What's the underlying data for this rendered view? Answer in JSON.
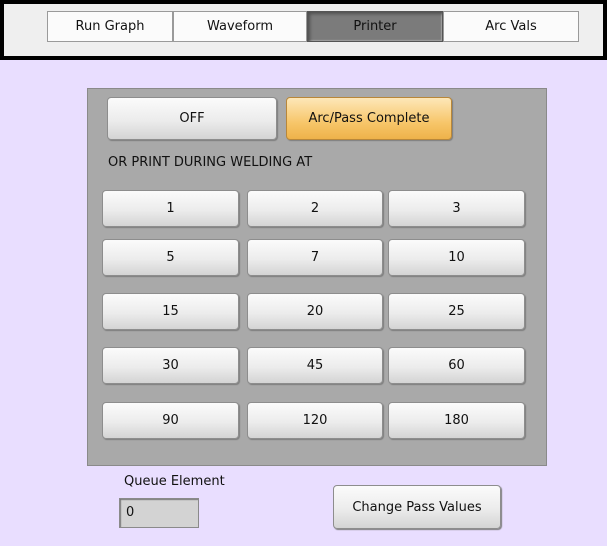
{
  "tabs": [
    {
      "label": "Run Graph",
      "active": false
    },
    {
      "label": "Waveform",
      "active": false
    },
    {
      "label": "Printer",
      "active": true
    },
    {
      "label": "Arc Vals",
      "active": false
    }
  ],
  "printer": {
    "off_label": "OFF",
    "arc_pass_label": "Arc/Pass Complete",
    "arc_pass_selected": true,
    "interval_heading": "OR PRINT DURING WELDING AT",
    "intervals": [
      "1",
      "2",
      "3",
      "5",
      "7",
      "10",
      "15",
      "20",
      "25",
      "30",
      "45",
      "60",
      "90",
      "120",
      "180"
    ]
  },
  "queue": {
    "label": "Queue Element",
    "value": "0"
  },
  "change_pass_label": "Change Pass Values",
  "colors": {
    "background": "#e9deff",
    "panel": "#a9a9a9",
    "lit_button": "#f7c66a",
    "active_tab": "#7b7b7b"
  }
}
